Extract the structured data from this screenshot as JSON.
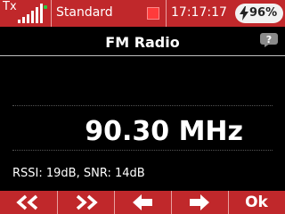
{
  "topbar": {
    "tx_label": "Tx",
    "signal_icon": "signal-bars-icon",
    "model_name": "Standard",
    "stop_icon": "stop-square-icon",
    "time": "17:17:17",
    "battery": "96%",
    "bolt_icon": "charging-bolt-icon",
    "accent_color": "#c0282b"
  },
  "screen": {
    "title": "FM Radio",
    "help_icon": "help-question-icon",
    "frequency": "90.30 MHz",
    "signal_info": "RSSI: 19dB, SNR: 14dB"
  },
  "bottombar": {
    "buttons": [
      {
        "icon": "double-chevron-left-icon"
      },
      {
        "icon": "double-chevron-right-icon"
      },
      {
        "icon": "arrow-left-icon"
      },
      {
        "icon": "arrow-right-icon"
      },
      {
        "label": "Ok"
      }
    ]
  }
}
